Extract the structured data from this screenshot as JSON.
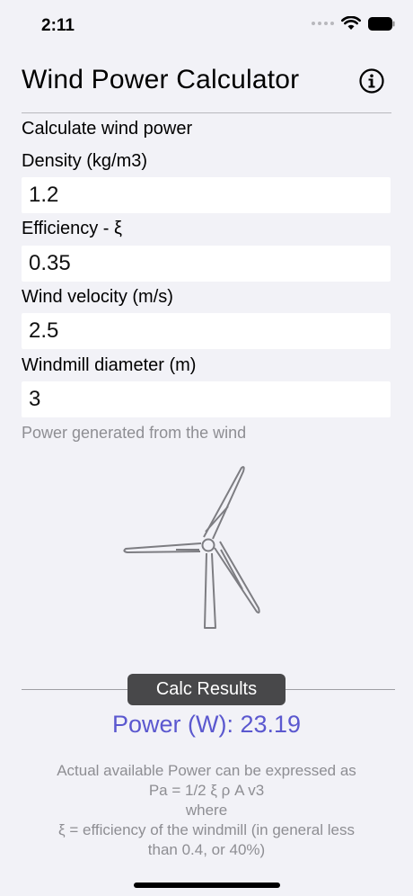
{
  "status": {
    "time": "2:11"
  },
  "header": {
    "title": "Wind Power Calculator"
  },
  "form": {
    "section_title": "Calculate wind power",
    "fields": [
      {
        "label": "Density (kg/m3)",
        "value": "1.2"
      },
      {
        "label": "Efficiency - ξ",
        "value": "0.35"
      },
      {
        "label": "Wind velocity (m/s)",
        "value": "2.5"
      },
      {
        "label": "Windmill diameter (m)",
        "value": "3"
      }
    ],
    "hint": "Power generated from the wind"
  },
  "results": {
    "button_label": "Calc Results",
    "power_text": "Power (W): 23.19",
    "explanation": [
      "Actual available Power can be expressed as",
      "Pa = 1/2 ξ ρ A v3",
      "where",
      "ξ = efficiency of the windmill (in general less",
      "than 0.4, or 40%)"
    ]
  },
  "colors": {
    "background": "#f2f2f7",
    "accent": "#5b58cf",
    "button": "#48484a",
    "secondary_text": "#8e8e93"
  },
  "icons": [
    "wifi-icon",
    "battery-icon",
    "info-icon",
    "wind-turbine-icon"
  ]
}
